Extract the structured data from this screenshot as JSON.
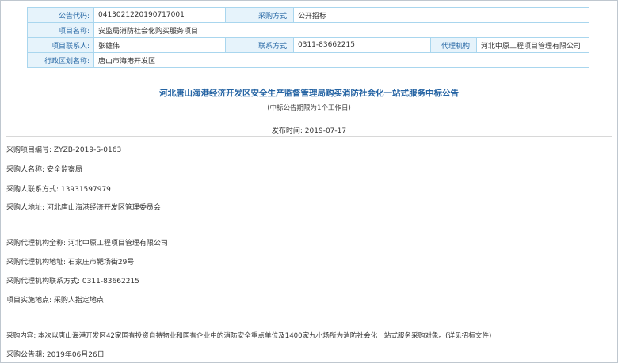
{
  "info": {
    "notice_code_label": "公告代码:",
    "notice_code": "0413021220190717001",
    "method_label": "采购方式:",
    "method": "公开招标",
    "project_name_label": "项目名称:",
    "project_name": "安监局消防社会化购买服务项目",
    "contact_label": "项目联系人:",
    "contact": "张雄伟",
    "phone_label": "联系方式:",
    "phone": "0311-83662215",
    "agency_label": "代理机构:",
    "agency": "河北中原工程项目管理有限公司",
    "region_label": "行政区划名称:",
    "region": "唐山市海港开发区"
  },
  "notice": {
    "title": "河北唐山海港经济开发区安全生产监督管理局购买消防社会化一站式服务中标公告",
    "subtitle": "(中标公告期限为1个工作日)",
    "pubdate_label": "发布时间:",
    "pubdate": "2019-07-17"
  },
  "details": {
    "proj_no_label": "采购项目编号:",
    "proj_no": "ZYZB-2019-S-0163",
    "buyer_label": "采购人名称:",
    "buyer": "安全监察局",
    "buyer_phone_label": "采购人联系方式:",
    "buyer_phone": "13931597979",
    "buyer_addr_label": "采购人地址:",
    "buyer_addr": "河北唐山海港经济开发区管理委员会",
    "agent_label": "采购代理机构全称:",
    "agent": "河北中原工程项目管理有限公司",
    "agent_addr_label": "采购代理机构地址:",
    "agent_addr": "石家庄市靶场街29号",
    "agent_phone_label": "采购代理机构联系方式:",
    "agent_phone": "0311-83662215",
    "site_label": "项目实施地点:",
    "site": "采购人指定地点",
    "content_label": "采购内容:",
    "content": "本次以唐山海港开发区42家国有投资自持物业和国有企业中的消防安全重点单位及1400家九小场所为消防社会化一站式服务采购对象。(详见招标文件)",
    "notice_date_label": "采购公告期:",
    "notice_date": "2019年06月26日"
  }
}
